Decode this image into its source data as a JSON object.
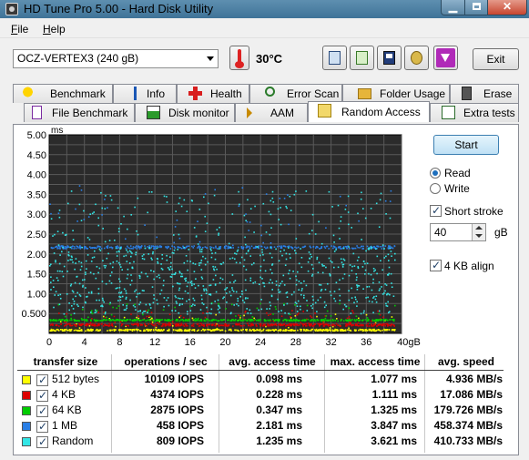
{
  "window": {
    "title": "HD Tune Pro 5.00 - Hard Disk Utility"
  },
  "menu": [
    {
      "label": "File",
      "u": "F",
      "rest": "ile"
    },
    {
      "label": "Help",
      "u": "H",
      "rest": "elp"
    }
  ],
  "toolbar": {
    "drive": "OCZ-VERTEX3 (240 gB)",
    "temperature": "30°C",
    "exit_label": "Exit",
    "icons": [
      "copy-info-icon",
      "copy-screen-icon",
      "save-icon",
      "options-icon",
      "download-icon"
    ]
  },
  "tabs_row1": [
    {
      "label": "Benchmark",
      "icon": "benchmark-icon"
    },
    {
      "label": "Info",
      "icon": "info-icon"
    },
    {
      "label": "Health",
      "icon": "health-icon"
    },
    {
      "label": "Error Scan",
      "icon": "error-scan-icon"
    },
    {
      "label": "Folder Usage",
      "icon": "folder-icon"
    },
    {
      "label": "Erase",
      "icon": "erase-icon"
    }
  ],
  "tabs_row2": [
    {
      "label": "File Benchmark",
      "icon": "file-benchmark-icon"
    },
    {
      "label": "Disk monitor",
      "icon": "disk-monitor-icon"
    },
    {
      "label": "AAM",
      "icon": "speaker-icon"
    },
    {
      "label": "Random Access",
      "icon": "random-access-icon",
      "active": true
    },
    {
      "label": "Extra tests",
      "icon": "extra-tests-icon"
    }
  ],
  "controls": {
    "start_label": "Start",
    "read_label": "Read",
    "write_label": "Write",
    "mode": "Read",
    "short_stroke_label": "Short stroke",
    "short_stroke_checked": true,
    "short_stroke_value": "40",
    "short_stroke_unit": "gB",
    "align_label": "4 KB align",
    "align_checked": true
  },
  "results": {
    "headers": [
      "transfer size",
      "operations / sec",
      "avg. access time",
      "max. access time",
      "avg. speed"
    ],
    "rows": [
      {
        "name": "512 bytes",
        "color": "#ffff00",
        "checked": true,
        "ops": "10109 IOPS",
        "avg": "0.098 ms",
        "max": "1.077 ms",
        "speed": "4.936 MB/s"
      },
      {
        "name": "4 KB",
        "color": "#dd0000",
        "checked": true,
        "ops": "4374 IOPS",
        "avg": "0.228 ms",
        "max": "1.111 ms",
        "speed": "17.086 MB/s"
      },
      {
        "name": "64 KB",
        "color": "#00cc00",
        "checked": true,
        "ops": "2875 IOPS",
        "avg": "0.347 ms",
        "max": "1.325 ms",
        "speed": "179.726 MB/s"
      },
      {
        "name": "1 MB",
        "color": "#2a7fe6",
        "checked": true,
        "ops": "458 IOPS",
        "avg": "2.181 ms",
        "max": "3.847 ms",
        "speed": "458.374 MB/s"
      },
      {
        "name": "Random",
        "color": "#33e6e6",
        "checked": true,
        "ops": "809 IOPS",
        "avg": "1.235 ms",
        "max": "3.621 ms",
        "speed": "410.733 MB/s"
      }
    ]
  },
  "chart_data": {
    "type": "scatter",
    "ylabel": "ms",
    "ylim": [
      0,
      5
    ],
    "xlim": [
      0,
      40
    ],
    "yticks": [
      "5.00",
      "4.50",
      "4.00",
      "3.50",
      "3.00",
      "2.50",
      "2.00",
      "1.50",
      "1.00",
      "0.500"
    ],
    "ytick_values": [
      5,
      4.5,
      4,
      3.5,
      3,
      2.5,
      2,
      1.5,
      1,
      0.5
    ],
    "xticks": [
      "0",
      "4",
      "8",
      "12",
      "16",
      "20",
      "24",
      "28",
      "32",
      "36",
      "40gB"
    ],
    "xtick_values": [
      0,
      4,
      8,
      12,
      16,
      20,
      24,
      28,
      32,
      36,
      40
    ],
    "grid": true,
    "background": "#2b2b2b",
    "series": [
      {
        "name": "512 bytes",
        "color": "#ffff00",
        "band": [
          0.08,
          0.12
        ],
        "scatter_max": 0.5,
        "points": 500
      },
      {
        "name": "4 KB",
        "color": "#dd0000",
        "band": [
          0.2,
          0.26
        ],
        "scatter_max": 0.6,
        "points": 500
      },
      {
        "name": "64 KB",
        "color": "#00cc00",
        "band": [
          0.33,
          0.37
        ],
        "scatter_max": 0.8,
        "points": 500
      },
      {
        "name": "1 MB",
        "color": "#2a7fe6",
        "band": [
          2.15,
          2.22
        ],
        "scatter_max": 3.8,
        "points": 400
      },
      {
        "name": "Random",
        "color": "#33e6e6",
        "band": [
          0.5,
          2.2
        ],
        "scatter_max": 3.6,
        "points": 900
      }
    ]
  }
}
